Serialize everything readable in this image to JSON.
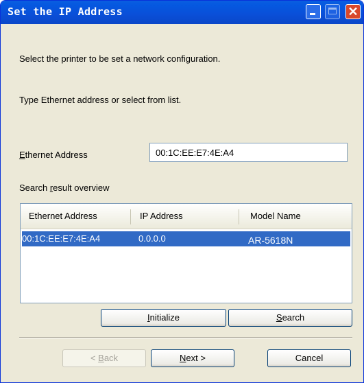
{
  "window": {
    "title": "Set the IP Address"
  },
  "instructions": {
    "line1": "Select the printer to be set a network configuration.",
    "line2": "Type Ethernet address or select from list."
  },
  "ethernet": {
    "label_prefix": "",
    "label_accel": "E",
    "label_suffix": "thernet Address",
    "value": "00:1C:EE:E7:4E:A4"
  },
  "search_result": {
    "label_prefix": "Search ",
    "label_accel": "r",
    "label_suffix": "esult overview"
  },
  "table": {
    "headers": [
      "Ethernet Address",
      "IP Address",
      "Model Name"
    ],
    "rows": [
      [
        "00:1C:EE:E7:4E:A4",
        "0.0.0.0",
        "AR-5618N"
      ]
    ]
  },
  "buttons": {
    "initialize": {
      "accel": "I",
      "rest": "nitialize"
    },
    "search": {
      "accel": "S",
      "rest": "earch"
    },
    "back": {
      "prefix": "< ",
      "accel": "B",
      "rest": "ack"
    },
    "next": {
      "accel": "N",
      "rest": "ext >"
    },
    "cancel": "Cancel"
  },
  "colors": {
    "titlebar": "#0a5fe0",
    "selection": "#316ac5",
    "dialog_bg": "#ece9d8"
  }
}
